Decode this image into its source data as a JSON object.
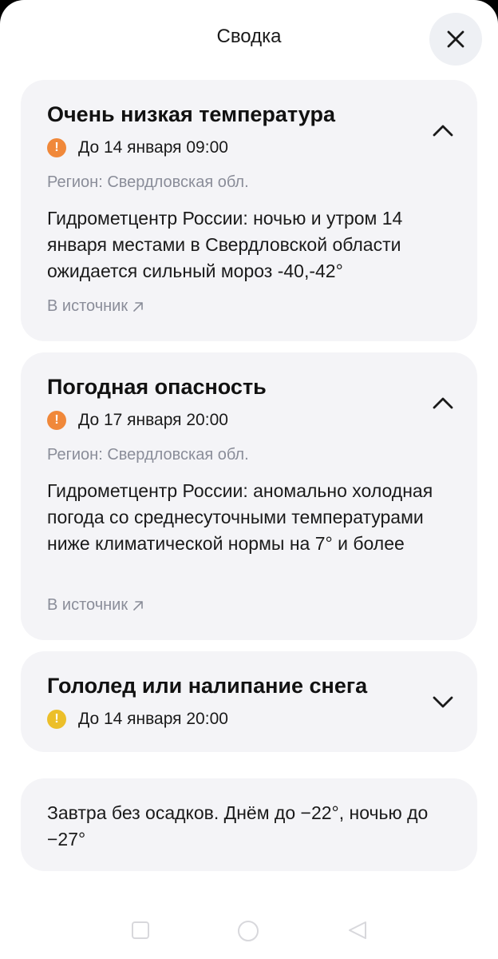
{
  "header": {
    "title": "Сводка",
    "close_icon": "close-icon"
  },
  "alerts": [
    {
      "title": "Очень низкая температура",
      "expanded": true,
      "level_color": "#f0883a",
      "date": "До 14 января 09:00",
      "region": "Регион: Свердловская обл.",
      "description": "Гидрометцентр России: ночью и утром 14 января местами в Свердловской области ожидается сильный мороз -40,-42°",
      "source_label": "В источник"
    },
    {
      "title": "Погодная опасность",
      "expanded": true,
      "level_color": "#f0883a",
      "date": "До 17 января 20:00",
      "region": "Регион: Свердловская обл.",
      "description": "Гидрометцентр России: аномально холодная погода со среднесуточными температурами ниже климатической нормы на 7° и более",
      "source_label": "В источник"
    },
    {
      "title": "Гололед или налипание снега",
      "expanded": false,
      "level_color": "#ecbf2a",
      "date": "До 14 января 20:00"
    }
  ],
  "forecast": {
    "text": "Завтра без осадков. Днём до −22°, ночью до −27°"
  },
  "navbar": {
    "icons": [
      "recents-icon",
      "home-icon",
      "back-icon"
    ]
  }
}
